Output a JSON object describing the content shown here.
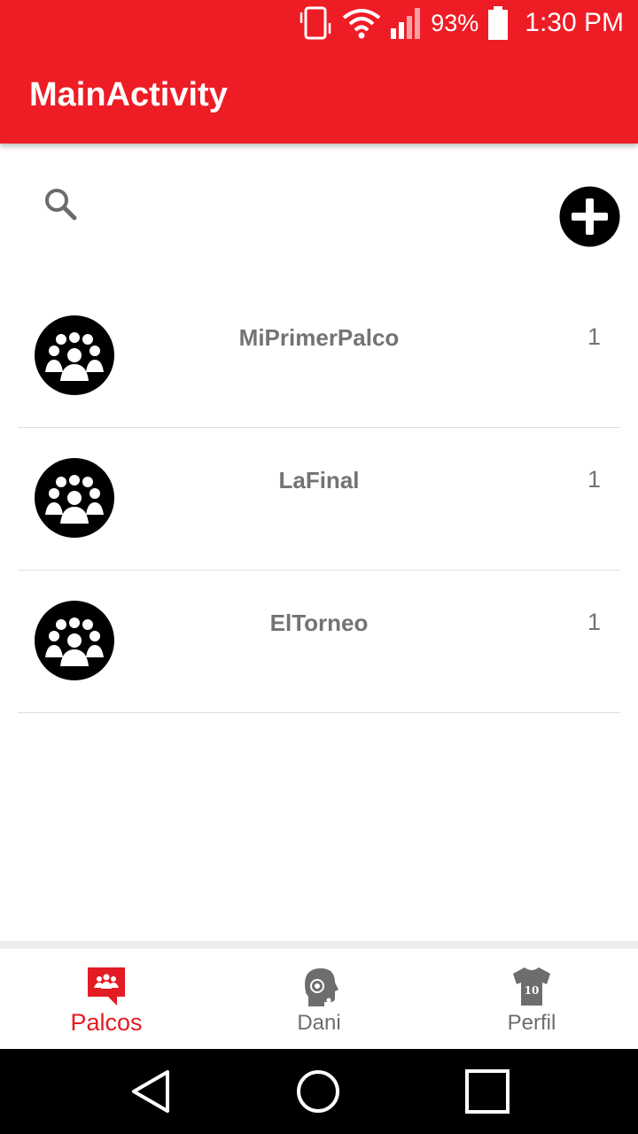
{
  "status_bar": {
    "battery_percent": "93%",
    "time": "1:30 PM"
  },
  "app_bar": {
    "title": "MainActivity"
  },
  "toolbar": {
    "search_icon": "search-icon",
    "add_icon": "add-circle-icon"
  },
  "palcos": [
    {
      "name": "MiPrimerPalco",
      "count": "1"
    },
    {
      "name": "LaFinal",
      "count": "1"
    },
    {
      "name": "ElTorneo",
      "count": "1"
    }
  ],
  "bottom_nav": {
    "items": [
      {
        "label": "Palcos",
        "icon": "group-chat-icon",
        "active": true
      },
      {
        "label": "Dani",
        "icon": "assistant-head-icon",
        "active": false
      },
      {
        "label": "Perfil",
        "icon": "jersey-icon",
        "active": false
      }
    ],
    "jersey_number": "10"
  },
  "colors": {
    "brand_red": "#ee1c25",
    "text_gray": "#737373",
    "active_red": "#e31b23"
  }
}
